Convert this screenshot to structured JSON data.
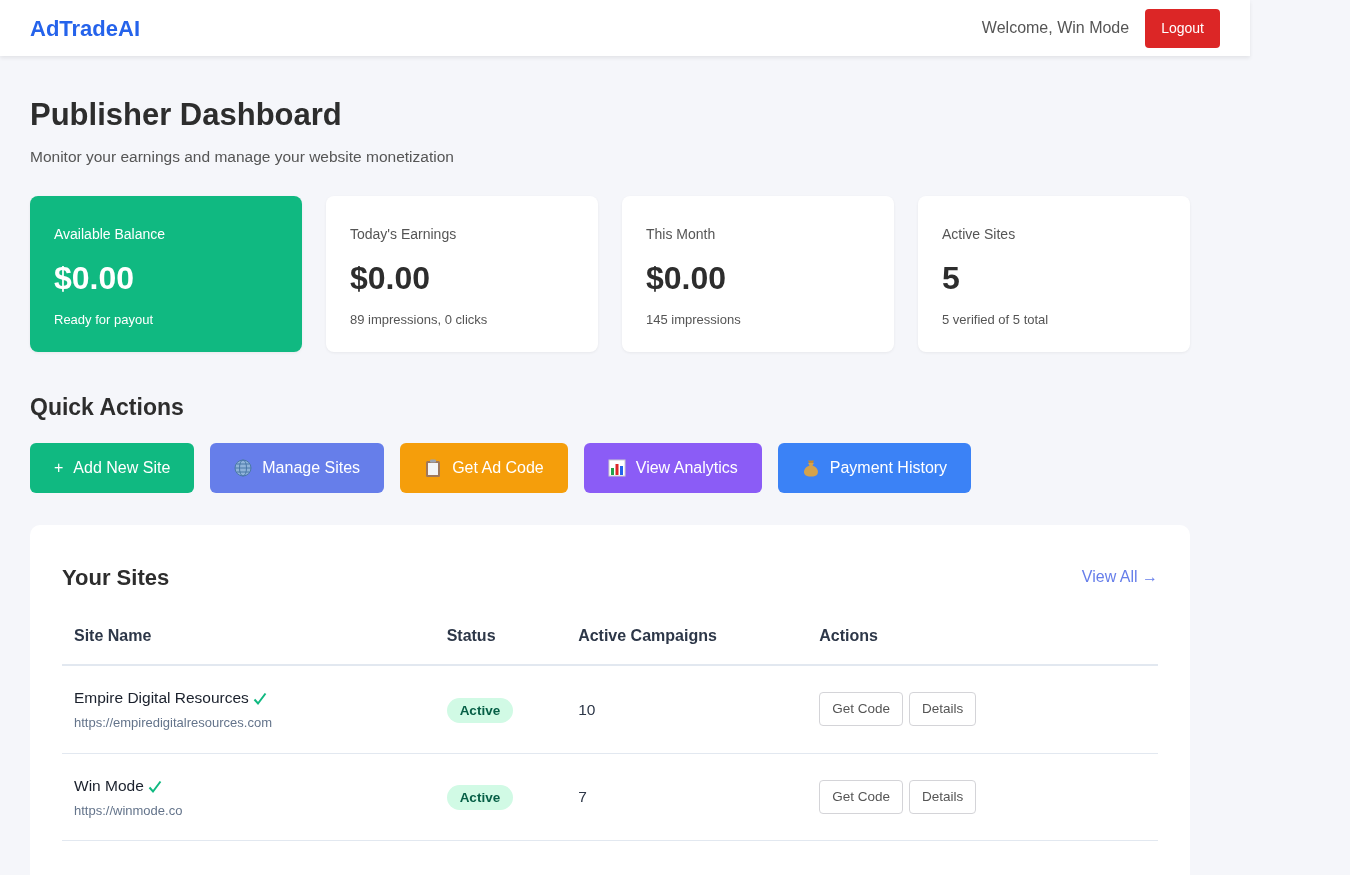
{
  "header": {
    "logo": "AdTradeAI",
    "welcome": "Welcome, Win Mode",
    "logout": "Logout"
  },
  "page": {
    "title": "Publisher Dashboard",
    "subtitle": "Monitor your earnings and manage your website monetization"
  },
  "stats": [
    {
      "label": "Available Balance",
      "value": "$0.00",
      "note": "Ready for payout",
      "kind": "highlight"
    },
    {
      "label": "Today's Earnings",
      "value": "$0.00",
      "note": "89 impressions, 0 clicks",
      "kind": "plain"
    },
    {
      "label": "This Month",
      "value": "$0.00",
      "note": "145 impressions",
      "kind": "plain"
    },
    {
      "label": "Active Sites",
      "value": "5",
      "note": "5 verified of 5 total",
      "kind": "plain"
    }
  ],
  "quick_actions": {
    "title": "Quick Actions",
    "buttons": [
      {
        "icon": "+",
        "label": "Add New Site",
        "color": "#10b981",
        "kind": "plus"
      },
      {
        "label": "Manage Sites",
        "color": "#667eea",
        "kind": "globe"
      },
      {
        "label": "Get Ad Code",
        "color": "#f59e0b",
        "kind": "clipboard"
      },
      {
        "label": "View Analytics",
        "color": "#8b5cf6",
        "kind": "chart"
      },
      {
        "label": "Payment History",
        "color": "#3b82f6",
        "kind": "moneybag"
      }
    ]
  },
  "sites": {
    "title": "Your Sites",
    "view_all": "View All →",
    "columns": [
      "Site Name",
      "Status",
      "Active Campaigns",
      "Actions"
    ],
    "rows": [
      {
        "name": "Empire Digital Resources",
        "verified": true,
        "url": "https://empiredigitalresources.com",
        "status": "Active",
        "campaigns": "10",
        "actions": [
          "Get Code",
          "Details"
        ]
      },
      {
        "name": "Win Mode",
        "verified": true,
        "url": "https://winmode.co",
        "status": "Active",
        "campaigns": "7",
        "actions": [
          "Get Code",
          "Details"
        ]
      }
    ]
  }
}
